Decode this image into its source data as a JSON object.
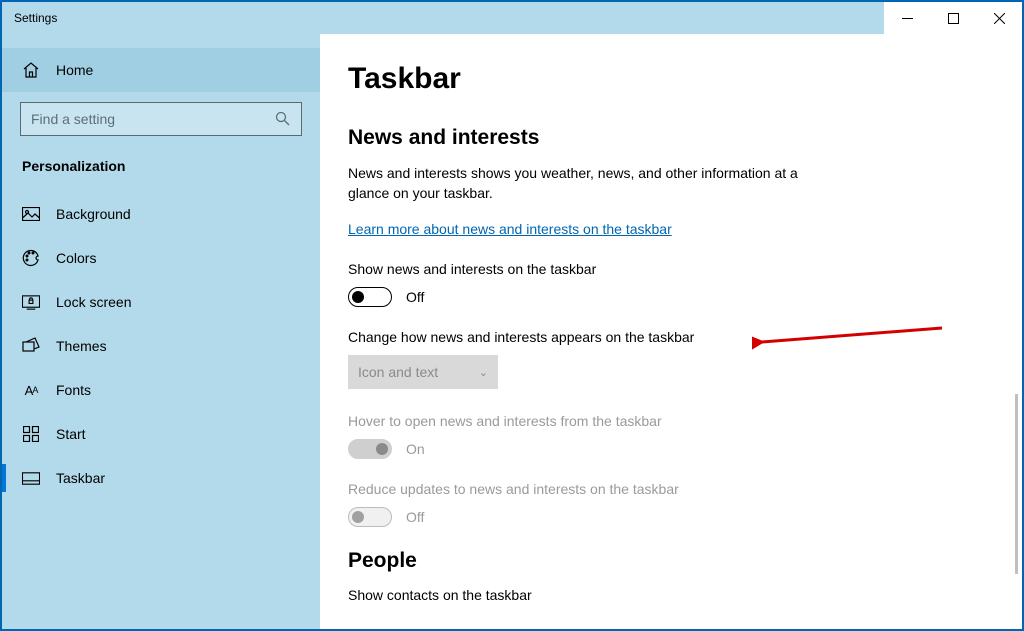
{
  "window": {
    "title": "Settings"
  },
  "sidebar": {
    "home": "Home",
    "search_placeholder": "Find a setting",
    "category": "Personalization",
    "items": [
      {
        "label": "Background"
      },
      {
        "label": "Colors"
      },
      {
        "label": "Lock screen"
      },
      {
        "label": "Themes"
      },
      {
        "label": "Fonts"
      },
      {
        "label": "Start"
      },
      {
        "label": "Taskbar"
      }
    ]
  },
  "main": {
    "title": "Taskbar",
    "section1": {
      "heading": "News and interests",
      "desc": "News and interests shows you weather, news, and other information at a glance on your taskbar.",
      "link": "Learn more about news and interests on the taskbar",
      "toggle1_label": "Show news and interests on the taskbar",
      "toggle1_state": "Off",
      "combo_label": "Change how news and interests appears on the taskbar",
      "combo_value": "Icon and text",
      "toggle2_label": "Hover to open news and interests from the taskbar",
      "toggle2_state": "On",
      "toggle3_label": "Reduce updates to news and interests on the taskbar",
      "toggle3_state": "Off"
    },
    "section2": {
      "heading": "People",
      "row1": "Show contacts on the taskbar"
    }
  }
}
